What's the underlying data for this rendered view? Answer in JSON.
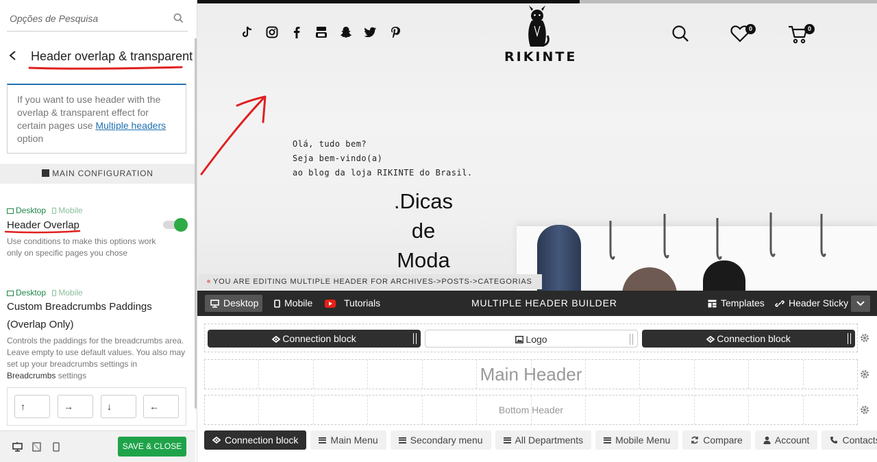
{
  "panel": {
    "search_placeholder": "Opções de Pesquisa",
    "section_title": "Header overlap & transparent",
    "info": {
      "text_before": "If you want to use header with the overlap & transparent effect for certain pages use ",
      "link": "Multiple headers",
      "text_after": " option"
    },
    "config_heading": "MAIN CONFIGURATION",
    "device_desktop": "Desktop",
    "device_mobile": "Mobile",
    "header_overlap": {
      "label": "Header Overlap",
      "desc": "Use conditions to make this options work only on specific pages you chose",
      "enabled": true
    },
    "breadcrumbs": {
      "label_line1": "Custom Breadcrumbs Paddings",
      "label_line2": "(Overlap Only)",
      "desc": "Controls the paddings for the breadcrumbs area. Leave empty to use default values. You also may set up your breadcrumbs settings in ",
      "desc_link": "Breadcrumbs",
      "desc_after": " settings",
      "arrows": [
        "↑",
        "→",
        "↓",
        "←"
      ]
    },
    "save_close": "SAVE & CLOSE"
  },
  "site": {
    "logo_text": "RIKINTE",
    "wishlist_count": "0",
    "cart_count": "0",
    "greeting": [
      "Olá, tudo bem?",
      "Seja bem-vindo(a)",
      "ao blog da loja RIKINTE do Brasil."
    ],
    "hero_title": [
      ".Dicas",
      "de",
      "Moda"
    ],
    "editing_notice": "YOU ARE EDITING MULTIPLE HEADER FOR ARCHIVES->POSTS->CATEGORIAS",
    "social_icons": [
      "tiktok-icon",
      "instagram-icon",
      "facebook-icon",
      "youtube-icon",
      "snapchat-icon",
      "twitter-icon",
      "pinterest-icon"
    ]
  },
  "builder": {
    "tab_desktop": "Desktop",
    "tab_mobile": "Mobile",
    "tab_tutorials": "Tutorials",
    "title": "MULTIPLE HEADER BUILDER",
    "templates": "Templates",
    "header_sticky": "Header Sticky",
    "top_row": {
      "left_block": "Connection block",
      "center_block": "Logo",
      "right_block": "Connection block"
    },
    "main_header": "Main Header",
    "bottom_header": "Bottom Header",
    "elements": [
      "Connection block",
      "Main Menu",
      "Secondary menu",
      "All Departments",
      "Mobile Menu",
      "Compare",
      "Account",
      "Contacts"
    ]
  },
  "colors": {
    "accent_green": "#1fa34a",
    "link_blue": "#2271b1",
    "annotation_red": "#e02020",
    "builder_dark": "#2a2a2a"
  }
}
